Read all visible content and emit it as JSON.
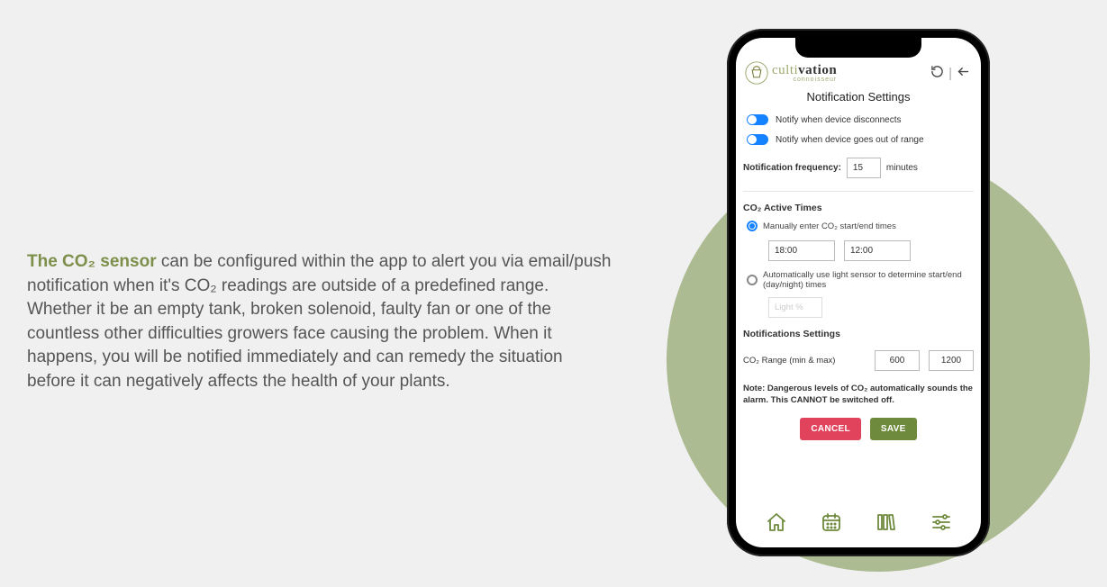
{
  "description": {
    "lead": "The CO₂ sensor",
    "body": " can be configured within the app to alert you via email/push notification when it's CO₂ readings are outside of a predefined range. Whether it be an empty tank, broken solenoid, faulty fan or one of the countless other difficulties growers face causing the problem. When it happens, you will be notified immediately and can remedy the situation before it can negatively affects the health of your plants."
  },
  "app": {
    "brand_culti": "culti",
    "brand_vation": "vation",
    "brand_sub": "connoisseur",
    "title": "Notification Settings",
    "toggle1": "Notify when device disconnects",
    "toggle2": "Notify when device goes out of range",
    "freq_label": "Notification frequency:",
    "freq_value": "15",
    "freq_unit": "minutes",
    "active_title": "CO₂ Active Times",
    "radio_manual": "Manually enter CO₂ start/end times",
    "time_start": "18:00",
    "time_end": "12:00",
    "radio_auto": "Automatically use light sensor to determine start/end (day/night) times",
    "light_placeholder": "Light %",
    "notif_title": "Notifications Settings",
    "range_label": "CO₂ Range (min & max)",
    "range_min": "600",
    "range_max": "1200",
    "note": "Note: Dangerous levels of CO₂ automatically sounds the alarm. This CANNOT be switched off.",
    "cancel": "CANCEL",
    "save": "SAVE"
  }
}
